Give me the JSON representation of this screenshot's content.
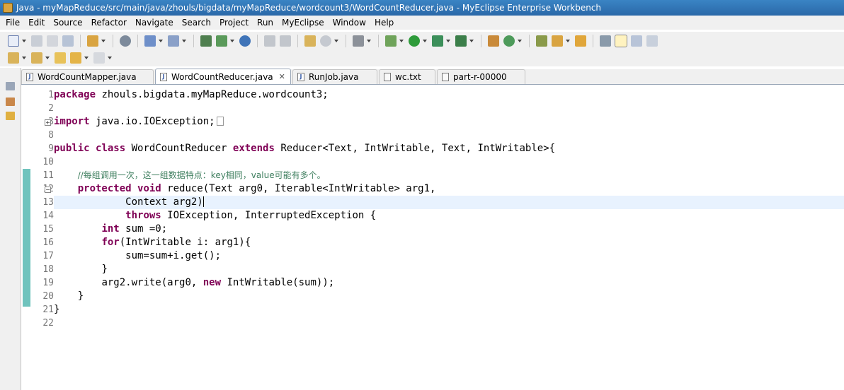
{
  "window": {
    "title": "Java - myMapReduce/src/main/java/zhouls/bigdata/myMapReduce/wordcount3/WordCountReducer.java - MyEclipse Enterprise Workbench"
  },
  "menu": [
    "File",
    "Edit",
    "Source",
    "Refactor",
    "Navigate",
    "Search",
    "Project",
    "Run",
    "MyEclipse",
    "Window",
    "Help"
  ],
  "tabs": [
    {
      "label": "WordCountMapper.java",
      "icon": "java-file-icon",
      "active": false
    },
    {
      "label": "WordCountReducer.java",
      "icon": "java-file-icon",
      "active": true,
      "close": "✕"
    },
    {
      "label": "RunJob.java",
      "icon": "java-file-icon",
      "active": false
    },
    {
      "label": "wc.txt",
      "icon": "text-file-icon",
      "active": false
    },
    {
      "label": "part-r-00000",
      "icon": "text-file-icon",
      "active": false
    }
  ],
  "editor": {
    "line_numbers": [
      "1",
      "2",
      "3",
      "8",
      "9",
      "10",
      "11",
      "12",
      "13",
      "14",
      "15",
      "16",
      "17",
      "18",
      "19",
      "20",
      "21",
      "22"
    ],
    "code": {
      "l1_kw": "package",
      "l1_rest": " zhouls.bigdata.myMapReduce.wordcount3;",
      "l3_kw": "import",
      "l3_rest": " java.io.IOException;",
      "l9_kw1": "public",
      "l9_kw2": "class",
      "l9_mid": " WordCountReducer ",
      "l9_kw3": "extends",
      "l9_rest": " Reducer<Text, IntWritable, Text, IntWritable>{",
      "l11_comment": "//每组调用一次，这一组数据特点：key相同，value可能有多个。",
      "l12_kw1": "protected",
      "l12_kw2": "void",
      "l12_rest": " reduce(Text arg0, Iterable<IntWritable> arg1,",
      "l13_text": "Context arg2)",
      "l14_kw": "throws",
      "l14_rest": " IOException, InterruptedException {",
      "l15_kw": "int",
      "l15_rest": " sum =0;",
      "l16_kw": "for",
      "l16_rest": "(IntWritable i: arg1){",
      "l17_text": "sum=sum+i.get();",
      "l18_text": "}",
      "l19_a": "arg2.write(arg0, ",
      "l19_kw": "new",
      "l19_b": " IntWritable(sum));",
      "l20_text": "}",
      "l21_text": "}"
    }
  },
  "colors": {
    "keyword": "#7f0055",
    "comment": "#3f7f5f",
    "change_bar": "#6fc3bd",
    "current_line": "#e8f2fe"
  }
}
